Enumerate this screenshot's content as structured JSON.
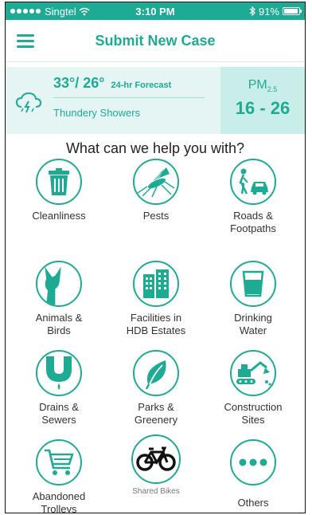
{
  "status_bar": {
    "carrier": "Singtel",
    "time": "3:10 PM",
    "battery": "91%",
    "icons": [
      "signal-dots-icon",
      "wifi-icon",
      "bluetooth-icon",
      "battery-icon"
    ]
  },
  "header": {
    "title": "Submit New Case",
    "menu_icon": "hamburger-icon"
  },
  "weather": {
    "temp": "33°/ 26°",
    "forecast_label": "24-hr Forecast",
    "condition": "Thundery Showers",
    "pm_label": "PM",
    "pm_sub": "2.5",
    "pm_value": "16 - 26",
    "icon": "thunder-cloud-icon"
  },
  "question": "What can we help you with?",
  "categories": [
    {
      "label": "Cleanliness",
      "icon": "trash-bin-icon"
    },
    {
      "label": "Pests",
      "icon": "mosquito-icon"
    },
    {
      "label": "Roads & Footpaths",
      "icon": "pedestrian-car-icon"
    },
    {
      "label": "Animals & Birds",
      "icon": "dog-icon"
    },
    {
      "label": "Facilities in HDB Estates",
      "icon": "buildings-icon"
    },
    {
      "label": "Drinking Water",
      "icon": "water-glass-icon"
    },
    {
      "label": "Drains & Sewers",
      "icon": "drain-pipe-icon"
    },
    {
      "label": "Parks & Greenery",
      "icon": "leaf-icon"
    },
    {
      "label": "Construction Sites",
      "icon": "excavator-icon"
    },
    {
      "label": "Abandoned Trolleys",
      "icon": "shopping-cart-icon"
    },
    {
      "label": "Shared Bikes",
      "icon": "bicycle-icon"
    },
    {
      "label": "Others",
      "icon": "more-dots-icon"
    }
  ],
  "colors": {
    "accent": "#1eab94",
    "weather_bg": "#e4f5f3",
    "pm_bg": "#c9ede8"
  }
}
